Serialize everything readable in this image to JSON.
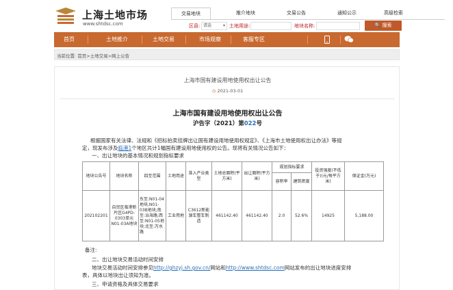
{
  "site": {
    "title": "上海土地市场",
    "url": "www.shtdsc.com",
    "logo_icon": "shanghai-land-market-logo"
  },
  "top_tabs": [
    {
      "label": "交易地块",
      "active": true
    },
    {
      "label": "推介地块",
      "active": false
    },
    {
      "label": "交易公告",
      "active": false
    },
    {
      "label": "通知公示",
      "active": false
    },
    {
      "label": "高级检索",
      "active": false
    }
  ],
  "search": {
    "district_label": "区县:",
    "district_value": "请选",
    "land_name_label": "土地用途:",
    "parcel_name_label": "地块名称:",
    "button_label": "搜索"
  },
  "nav": {
    "items": [
      "首页",
      "土地推介",
      "土地交易",
      "市场观察",
      "客服专区"
    ],
    "mobile_icon": "mobile-phone-icon",
    "wechat_icon": "wechat-icon"
  },
  "breadcrumb": {
    "prefix": "当前位置:",
    "path": "首页>土地交易>网上公告"
  },
  "article": {
    "title": "上海市国有建设用地使用权出让公告",
    "date": "2021-03-01",
    "heading": "上海市国有建设用地使用权出让公告",
    "doc_prefix": "沪告字（2021）第",
    "doc_num": "022",
    "doc_suffix": "号",
    "intro_1": "根据国家有关法律、法规和《招标拍卖挂牌出让国有建设用地使用权规定》、《上海市土地使用权出让办法》等规",
    "intro_2a": "定，现发布涉及",
    "intro_2_link": "临港1",
    "intro_2b": "个地区共计1幅国有建设用地使用权的公告。现将有关情况公告如下：",
    "section_1": "一、出让地块的基本情况和规划指标要求",
    "note": "备注:",
    "section_2": "二、出让地块交易活动时间安排",
    "line_a": "地块交易活动时间安排参见",
    "line_link1": "http://ghzyj.sh.gov.cn/",
    "line_b": "网站和",
    "line_link2": "http://www.shtdsc.com",
    "line_c": "网站发布的出让地块进度安排",
    "line_d": "表，具体以地块出让须知为准。",
    "section_3": "三、申请资格及具体交易要求"
  },
  "table": {
    "headers": {
      "id": "地块公告号",
      "name": "地块名称",
      "range": "四至范围",
      "use": "土地用途",
      "industry": "准入产业类型",
      "area": "土地总面积(平方米)",
      "sell_area": "出让面积(平方米)",
      "plan": "规划指标要求",
      "far": "容积率",
      "density": "建筑密度",
      "invest": "投资强度(不低于)(元/每平方米)",
      "deposit": "保证金(万元)"
    },
    "row": {
      "id": "202102201",
      "name": "自贸区临港新片区G4PD-0303单元N01-03A地块",
      "range": "东至:N01-04地块,N01-03B地块;南至:治海路;西至:N01-05地块;北至:万水路",
      "use": "工业用地",
      "industry": "C3612新能源车整车制造",
      "area": "461142.40",
      "sell_area": "461142.40",
      "far": "2.0",
      "density": "52.6%",
      "invest": "14925",
      "deposit": "5,188.00"
    }
  }
}
